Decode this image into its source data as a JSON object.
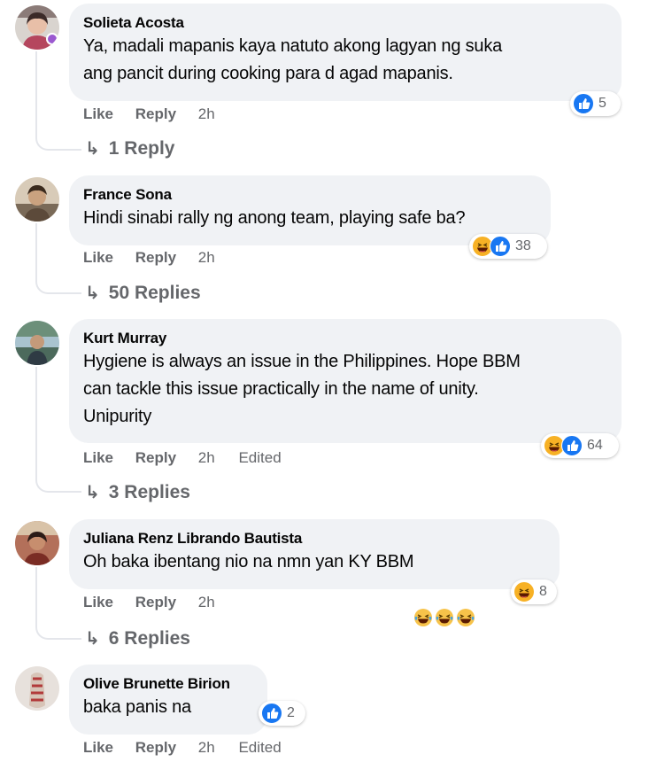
{
  "comments": [
    {
      "author": "Solieta Acosta",
      "text": "Ya, madali mapanis kaya natuto akong lagyan ng suka\nang pancit during cooking para d agad mapanis.",
      "like_label": "Like",
      "reply_label": "Reply",
      "time": "2h",
      "reaction_icons": [
        "like-icon"
      ],
      "reaction_count": "5",
      "replies_label": "1 Reply"
    },
    {
      "author": "France Sona",
      "text": "Hindi sinabi rally ng anong team, playing safe ba?",
      "like_label": "Like",
      "reply_label": "Reply",
      "time": "2h",
      "reaction_icons": [
        "haha-icon",
        "like-icon"
      ],
      "reaction_count": "38",
      "replies_label": "50 Replies"
    },
    {
      "author": "Kurt Murray",
      "text": "Hygiene is always an issue in the Philippines. Hope BBM\ncan tackle this issue practically in the name of unity.\nUnipurity",
      "like_label": "Like",
      "reply_label": "Reply",
      "time": "2h",
      "edited": "Edited",
      "reaction_icons": [
        "haha-icon",
        "like-icon"
      ],
      "reaction_count": "64",
      "replies_label": "3 Replies"
    },
    {
      "author": "Juliana Renz Librando Bautista",
      "text": "Oh baka ibentang nio na nmn yan KY BBM",
      "text_emojis": [
        "laughing-crying-emoji",
        "laughing-crying-emoji",
        "laughing-crying-emoji"
      ],
      "like_label": "Like",
      "reply_label": "Reply",
      "time": "2h",
      "reaction_icons": [
        "haha-icon"
      ],
      "reaction_count": "8",
      "replies_label": "6 Replies"
    },
    {
      "author": "Olive Brunette Birion",
      "text": "baka panis na",
      "like_label": "Like",
      "reply_label": "Reply",
      "time": "2h",
      "edited": "Edited",
      "reaction_icons": [
        "like-icon"
      ],
      "reaction_count": "2"
    }
  ],
  "colors": {
    "bubble": "#f0f2f5",
    "secondary_text": "#65676b",
    "like_blue": "#1877f2",
    "haha_yellow": "#f7b125"
  }
}
